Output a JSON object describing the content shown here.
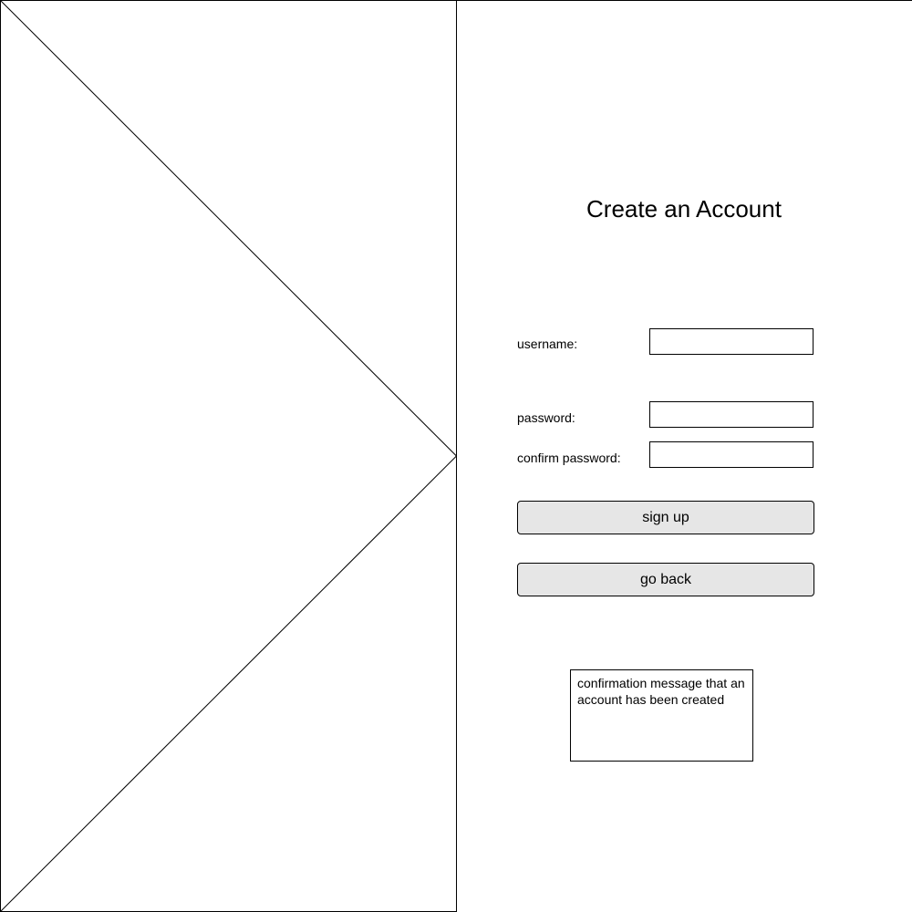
{
  "page": {
    "title": "Create an Account"
  },
  "image_placeholder": {
    "icon": "image-placeholder-icon"
  },
  "form": {
    "username": {
      "label": "username:",
      "value": "",
      "placeholder": ""
    },
    "password": {
      "label": "password:",
      "value": "",
      "placeholder": ""
    },
    "confirm_password": {
      "label": "confirm password:",
      "value": "",
      "placeholder": ""
    }
  },
  "buttons": {
    "sign_up": "sign up",
    "go_back": "go back"
  },
  "confirmation": {
    "message": "confirmation message that an account has been created"
  }
}
